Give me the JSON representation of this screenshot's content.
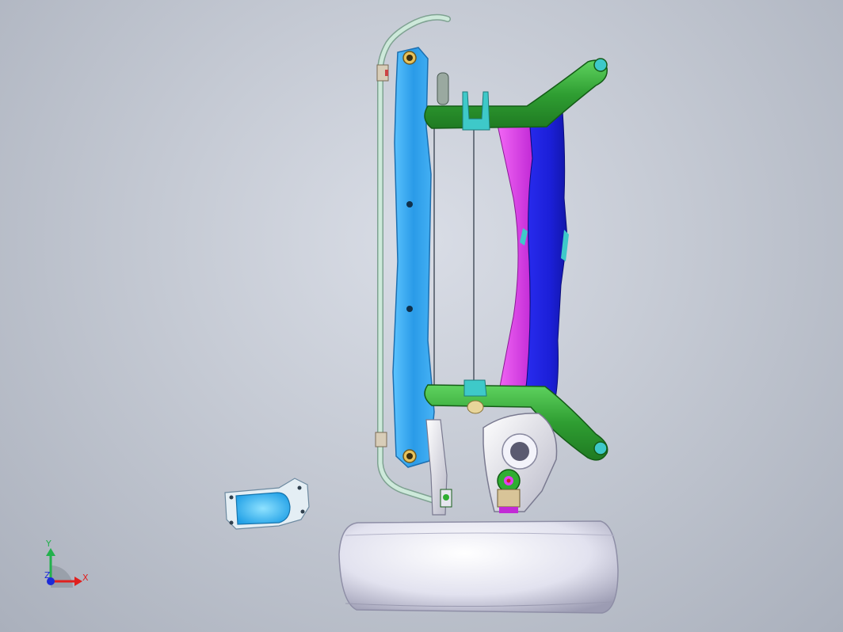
{
  "viewport": {
    "background_top": "#d9dde6",
    "background_bottom": "#aab0bc"
  },
  "model": {
    "parts": [
      {
        "name": "stabilizer-bar",
        "color": "#b7d8c8"
      },
      {
        "name": "front-crossmember",
        "color": "#3aa6ee"
      },
      {
        "name": "rear-crossmember-blue",
        "color": "#1b1fd8"
      },
      {
        "name": "rear-crossmember-magenta",
        "color": "#e040f0"
      },
      {
        "name": "mounting-tubes",
        "color": "#2fae32"
      },
      {
        "name": "mount-brackets",
        "color": "#3ec9c9"
      },
      {
        "name": "control-arm",
        "color": "#e8e8f0"
      },
      {
        "name": "tire",
        "color": "#e6e6f2"
      },
      {
        "name": "loose-bracket",
        "color": "#2fb6f0"
      }
    ]
  },
  "triad": {
    "y_label": "Y",
    "z_label": "Z",
    "x_label": "X",
    "y_color": "#22b14c",
    "x_color": "#e0201e",
    "z_color": "#1c2bd8"
  }
}
